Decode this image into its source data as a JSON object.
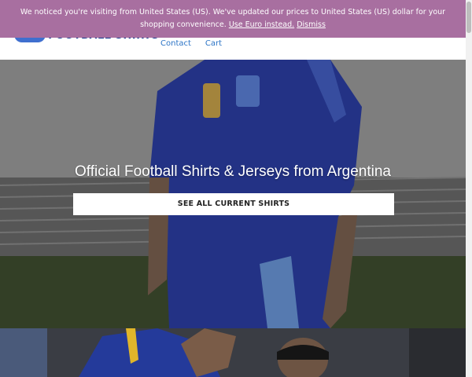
{
  "header": {
    "logo_text": "FOOTBALL SHIRTS",
    "nav": [
      {
        "label": "Contact"
      },
      {
        "label": "Cart"
      }
    ]
  },
  "notice": {
    "message": "We noticed you're visiting from United States (US). We've updated our prices to United States (US) dollar for your shopping convenience.",
    "use_euro": "Use Euro instead.",
    "dismiss": "Dismiss"
  },
  "hero": {
    "title": "Official Football Shirts & Jerseys from Argentina",
    "button": "SEE ALL CURRENT SHIRTS"
  },
  "colors": {
    "notice_bg": "#a86fa0",
    "link": "#2c74c6",
    "jersey_blue": "#2b3ea3",
    "jersey_stripe": "#7fb3e8"
  }
}
